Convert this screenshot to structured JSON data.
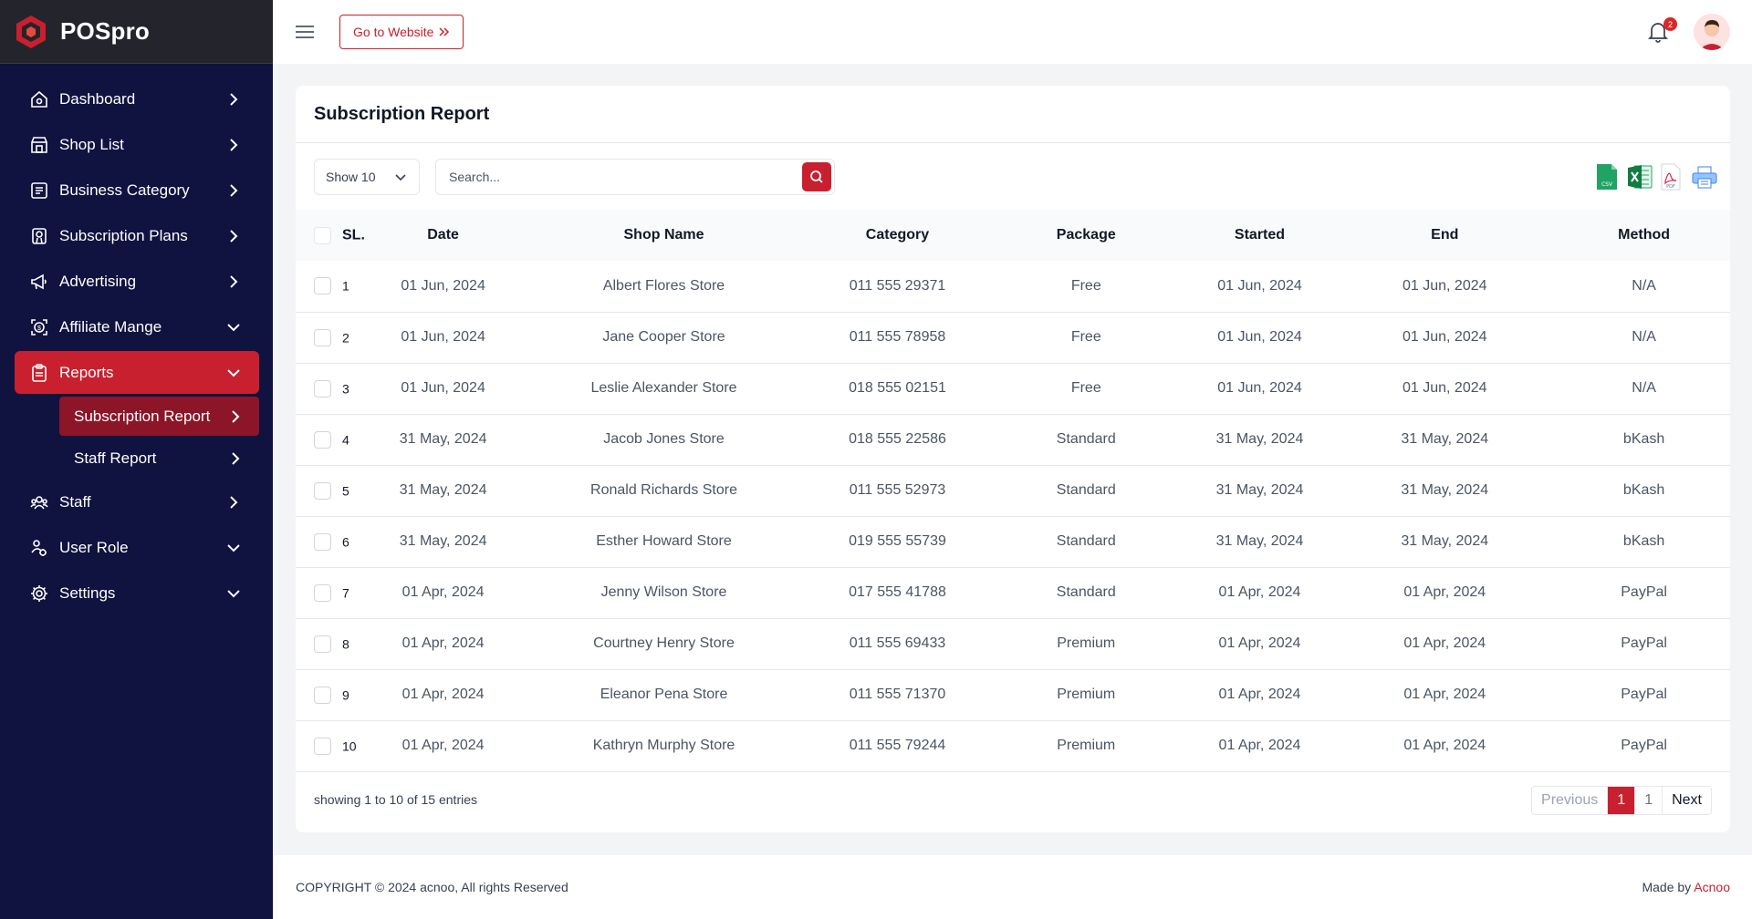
{
  "brand": {
    "name": "POSpro"
  },
  "sidebar": {
    "items": [
      {
        "label": "Dashboard",
        "icon": "home-icon",
        "chevron": "right"
      },
      {
        "label": "Shop List",
        "icon": "store-icon",
        "chevron": "right"
      },
      {
        "label": "Business Category",
        "icon": "list-icon",
        "chevron": "right"
      },
      {
        "label": "Subscription Plans",
        "icon": "badge-icon",
        "chevron": "right"
      },
      {
        "label": "Advertising",
        "icon": "megaphone-icon",
        "chevron": "right"
      },
      {
        "label": "Affiliate Mange",
        "icon": "affiliate-icon",
        "chevron": "down"
      },
      {
        "label": "Reports",
        "icon": "report-icon",
        "chevron": "down",
        "active": true
      },
      {
        "label": "Staff",
        "icon": "staff-icon",
        "chevron": "right"
      },
      {
        "label": "User Role",
        "icon": "user-role-icon",
        "chevron": "down"
      },
      {
        "label": "Settings",
        "icon": "gear-icon",
        "chevron": "down"
      }
    ],
    "reports_sub": [
      {
        "label": "Subscription Report",
        "active": true
      },
      {
        "label": "Staff Report"
      }
    ]
  },
  "topbar": {
    "goto_label": "Go to Website",
    "notification_count": "2"
  },
  "page": {
    "title": "Subscription Report",
    "show_label": "Show 10",
    "search_placeholder": "Search..."
  },
  "table": {
    "columns": [
      "SL.",
      "Date",
      "Shop Name",
      "Category",
      "Package",
      "Started",
      "End",
      "Method"
    ],
    "rows": [
      [
        "1",
        "01 Jun, 2024",
        "Albert Flores Store",
        "011 555 29371",
        "Free",
        "01 Jun, 2024",
        "01 Jun, 2024",
        "N/A"
      ],
      [
        "2",
        "01 Jun, 2024",
        "Jane Cooper Store",
        "011 555 78958",
        "Free",
        "01 Jun, 2024",
        "01 Jun, 2024",
        "N/A"
      ],
      [
        "3",
        "01 Jun, 2024",
        "Leslie Alexander Store",
        "018 555 02151",
        "Free",
        "01 Jun, 2024",
        "01 Jun, 2024",
        "N/A"
      ],
      [
        "4",
        "31 May, 2024",
        "Jacob Jones Store",
        "018 555 22586",
        "Standard",
        "31 May, 2024",
        "31 May, 2024",
        "bKash"
      ],
      [
        "5",
        "31 May, 2024",
        "Ronald Richards Store",
        "011 555 52973",
        "Standard",
        "31 May, 2024",
        "31 May, 2024",
        "bKash"
      ],
      [
        "6",
        "31 May, 2024",
        "Esther Howard Store",
        "019 555 55739",
        "Standard",
        "31 May, 2024",
        "31 May, 2024",
        "bKash"
      ],
      [
        "7",
        "01 Apr, 2024",
        "Jenny Wilson Store",
        "017 555 41788",
        "Standard",
        "01 Apr, 2024",
        "01 Apr, 2024",
        "PayPal"
      ],
      [
        "8",
        "01 Apr, 2024",
        "Courtney Henry Store",
        "011 555 69433",
        "Premium",
        "01 Apr, 2024",
        "01 Apr, 2024",
        "PayPal"
      ],
      [
        "9",
        "01 Apr, 2024",
        "Eleanor Pena Store",
        "011 555 71370",
        "Premium",
        "01 Apr, 2024",
        "01 Apr, 2024",
        "PayPal"
      ],
      [
        "10",
        "01 Apr, 2024",
        "Kathryn Murphy Store",
        "011 555 79244",
        "Premium",
        "01 Apr, 2024",
        "01 Apr, 2024",
        "PayPal"
      ]
    ]
  },
  "pagination": {
    "info": "showing 1 to 10 of 15 entries",
    "previous": "Previous",
    "current": "1",
    "page": "1",
    "next": "Next"
  },
  "footer": {
    "copyright": "COPYRIGHT © 2024 acnoo, All rights Reserved",
    "made_by": "Made by ",
    "made_by_name": "Acnoo"
  },
  "colors": {
    "accent": "#c8202e",
    "sidebar_bg": "#10123f",
    "brand_bg": "#24242c",
    "sub_active": "#8c1528"
  }
}
